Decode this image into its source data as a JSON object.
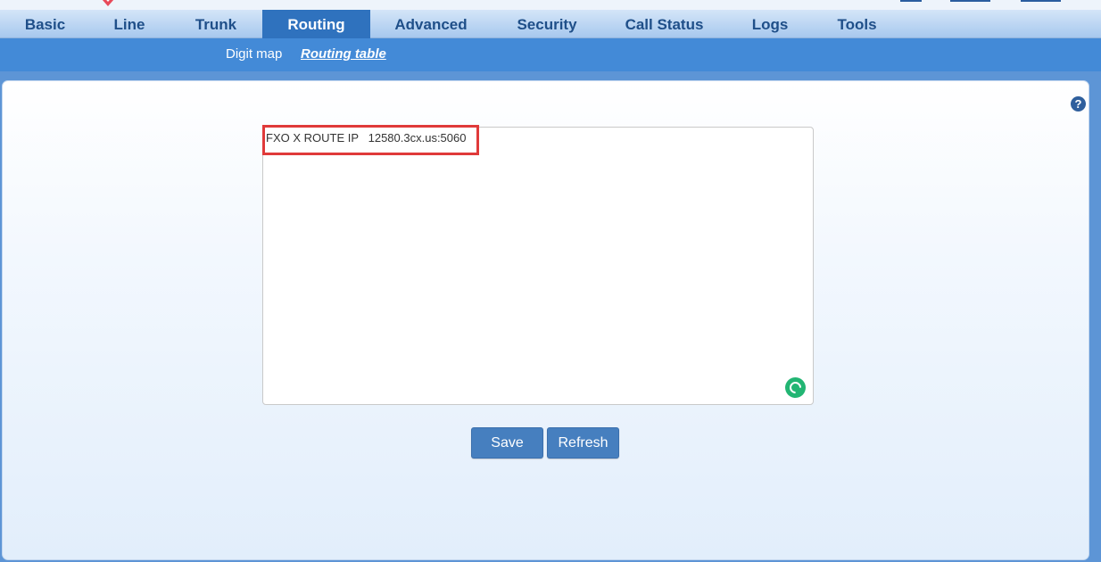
{
  "nav": {
    "tabs": [
      {
        "label": "Basic"
      },
      {
        "label": "Line"
      },
      {
        "label": "Trunk"
      },
      {
        "label": "Routing",
        "active": true
      },
      {
        "label": "Advanced"
      },
      {
        "label": "Security"
      },
      {
        "label": "Call Status"
      },
      {
        "label": "Logs"
      },
      {
        "label": "Tools"
      }
    ]
  },
  "subnav": {
    "items": [
      {
        "label": "Digit map"
      },
      {
        "label": "Routing table",
        "active": true
      }
    ]
  },
  "routing_table": {
    "value": "FXO X ROUTE IP   12580.3cx.us:5060"
  },
  "icons": {
    "help": "help-icon",
    "status": "grammar-check-icon"
  },
  "help": {
    "label": "?"
  },
  "actions": {
    "save_label": "Save",
    "refresh_label": "Refresh"
  },
  "colors": {
    "accent": "#2f72be",
    "subnav": "#438ad7",
    "button": "#467fbf",
    "highlight": "#e03a3a"
  }
}
